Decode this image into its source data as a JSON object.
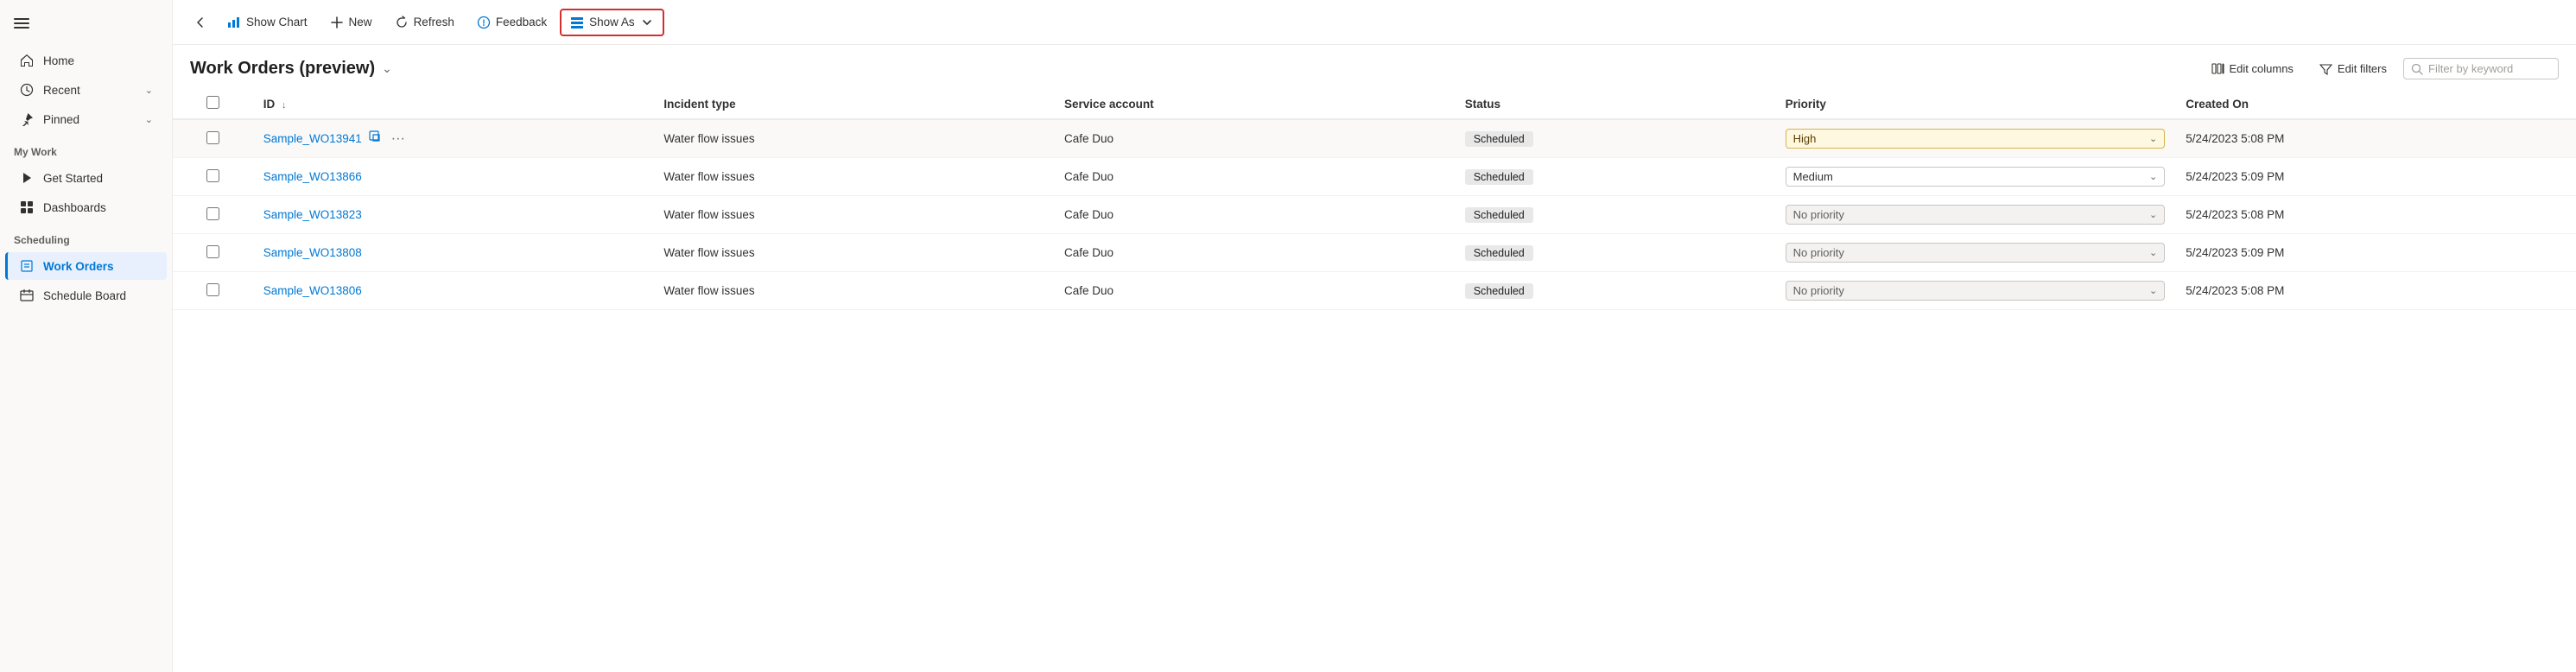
{
  "sidebar": {
    "nav_items": [
      {
        "id": "home",
        "label": "Home",
        "icon": "home-icon",
        "has_chevron": false,
        "active": false
      },
      {
        "id": "recent",
        "label": "Recent",
        "icon": "recent-icon",
        "has_chevron": true,
        "active": false
      },
      {
        "id": "pinned",
        "label": "Pinned",
        "icon": "pin-icon",
        "has_chevron": true,
        "active": false
      }
    ],
    "my_work_title": "My Work",
    "my_work_items": [
      {
        "id": "get-started",
        "label": "Get Started",
        "icon": "play-icon",
        "active": false
      },
      {
        "id": "dashboards",
        "label": "Dashboards",
        "icon": "dashboard-icon",
        "active": false
      }
    ],
    "scheduling_title": "Scheduling",
    "scheduling_items": [
      {
        "id": "work-orders",
        "label": "Work Orders",
        "icon": "workorder-icon",
        "active": true
      },
      {
        "id": "schedule-board",
        "label": "Schedule Board",
        "icon": "schedule-icon",
        "active": false
      }
    ]
  },
  "toolbar": {
    "back_label": "←",
    "show_chart_label": "Show Chart",
    "new_label": "New",
    "refresh_label": "Refresh",
    "feedback_label": "Feedback",
    "show_as_label": "Show As"
  },
  "page_header": {
    "title": "Work Orders (preview)",
    "edit_columns_label": "Edit columns",
    "edit_filters_label": "Edit filters",
    "filter_placeholder": "Filter by keyword"
  },
  "table": {
    "columns": [
      {
        "id": "checkbox",
        "label": ""
      },
      {
        "id": "id",
        "label": "ID",
        "sortable": true
      },
      {
        "id": "incident_type",
        "label": "Incident type"
      },
      {
        "id": "service_account",
        "label": "Service account"
      },
      {
        "id": "status",
        "label": "Status"
      },
      {
        "id": "priority",
        "label": "Priority"
      },
      {
        "id": "created_on",
        "label": "Created On"
      }
    ],
    "rows": [
      {
        "id": "Sample_WO13941",
        "incident_type": "Water flow issues",
        "service_account": "Cafe Duo",
        "status": "Scheduled",
        "priority": "High",
        "priority_class": "high",
        "created_on": "5/24/2023 5:08 PM",
        "is_first": true
      },
      {
        "id": "Sample_WO13866",
        "incident_type": "Water flow issues",
        "service_account": "Cafe Duo",
        "status": "Scheduled",
        "priority": "Medium",
        "priority_class": "medium",
        "created_on": "5/24/2023 5:09 PM",
        "is_first": false
      },
      {
        "id": "Sample_WO13823",
        "incident_type": "Water flow issues",
        "service_account": "Cafe Duo",
        "status": "Scheduled",
        "priority": "No priority",
        "priority_class": "no-priority",
        "created_on": "5/24/2023 5:08 PM",
        "is_first": false
      },
      {
        "id": "Sample_WO13808",
        "incident_type": "Water flow issues",
        "service_account": "Cafe Duo",
        "status": "Scheduled",
        "priority": "No priority",
        "priority_class": "no-priority",
        "created_on": "5/24/2023 5:09 PM",
        "is_first": false
      },
      {
        "id": "Sample_WO13806",
        "incident_type": "Water flow issues",
        "service_account": "Cafe Duo",
        "status": "Scheduled",
        "priority": "No priority",
        "priority_class": "no-priority",
        "created_on": "5/24/2023 5:08 PM",
        "is_first": false
      }
    ]
  }
}
